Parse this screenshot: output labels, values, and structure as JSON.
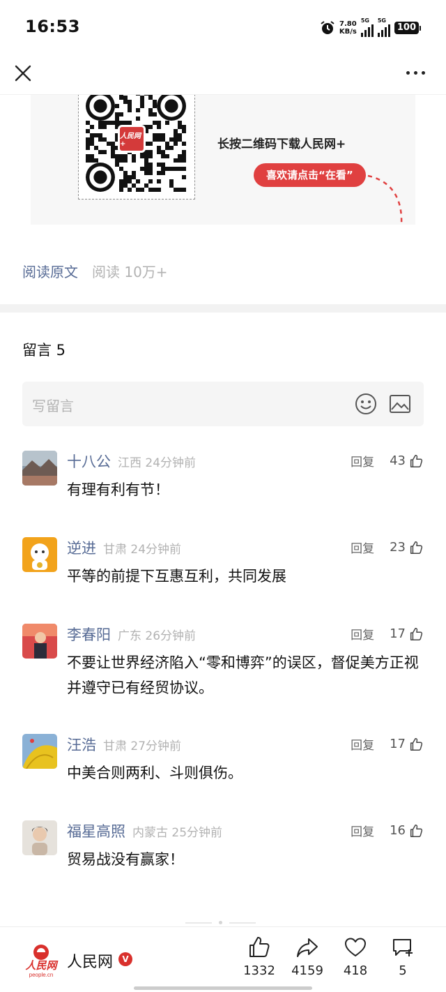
{
  "status_bar": {
    "time": "16:53",
    "net_speed_value": "7.80",
    "net_speed_unit": "KB/s",
    "signal_1_label": "5G",
    "signal_2_label": "5G",
    "battery": "100"
  },
  "banner": {
    "qr_logo_text": "人民网+",
    "title": "长按二维码下载人民网+",
    "pill_label": "喜欢请点击“在看”"
  },
  "article_meta": {
    "read_original": "阅读原文",
    "read_count": "阅读 10万+"
  },
  "comments": {
    "title": "留言 5",
    "write_placeholder": "写留言",
    "reply_label": "回复",
    "items": [
      {
        "name": "十八公",
        "meta": "江西 24分钟前",
        "likes": "43",
        "text": "有理有利有节！"
      },
      {
        "name": "逆进",
        "meta": "甘肃 24分钟前",
        "likes": "23",
        "text": "平等的前提下互惠互利，共同发展"
      },
      {
        "name": "李春阳",
        "meta": "广东 26分钟前",
        "likes": "17",
        "text": "不要让世界经济陷入“零和博弈”的误区，督促美方正视并遵守已有经贸协议。"
      },
      {
        "name": "汪浩",
        "meta": "甘肃 27分钟前",
        "likes": "17",
        "text": "中美合则两利、斗则俱伤。"
      },
      {
        "name": "福星高照",
        "meta": "内蒙古 25分钟前",
        "likes": "16",
        "text": "贸易战没有赢家！"
      }
    ]
  },
  "bottom_bar": {
    "brand_name": "人民网",
    "brand_badge": "V",
    "brand_logo_text": "人民网",
    "brand_logo_url": "people.cn",
    "like_count": "1332",
    "share_count": "4159",
    "favorite_count": "418",
    "comment_count": "5"
  },
  "colors": {
    "link": "#576b95",
    "accent_red": "#e04040"
  }
}
